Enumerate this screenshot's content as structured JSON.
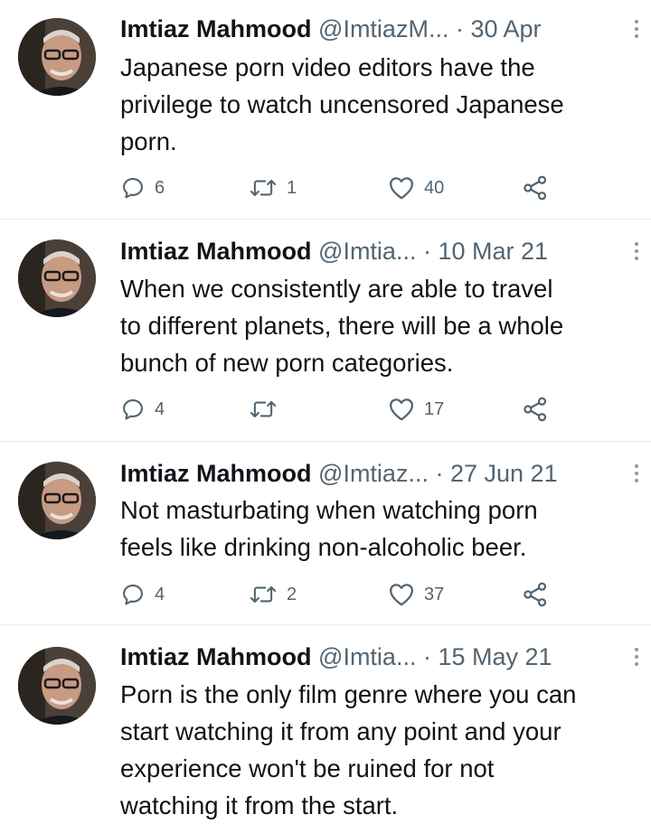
{
  "tweets": [
    {
      "author_name": "Imtiaz Mahmood",
      "handle": "@ImtiazM...",
      "separator": "·",
      "date": "30 Apr",
      "text_lines": [
        "Japanese porn video editors have the",
        "privilege to watch uncensored Japanese",
        "porn."
      ],
      "replies": "6",
      "retweets": "1",
      "likes": "40"
    },
    {
      "author_name": "Imtiaz Mahmood",
      "handle": "@Imtia...",
      "separator": "·",
      "date": "10 Mar 21",
      "text_lines": [
        "When we consistently are able to travel",
        "to different planets, there will be a whole",
        "bunch of new porn categories."
      ],
      "replies": "4",
      "retweets": "",
      "likes": "17"
    },
    {
      "author_name": "Imtiaz Mahmood",
      "handle": "@Imtiaz...",
      "separator": "·",
      "date": "27 Jun 21",
      "text_lines": [
        "Not masturbating when watching porn",
        "feels like drinking non-alcoholic beer."
      ],
      "replies": "4",
      "retweets": "2",
      "likes": "37"
    },
    {
      "author_name": "Imtiaz Mahmood",
      "handle": "@Imtia...",
      "separator": "·",
      "date": "15 May 21",
      "text_lines": [
        "Porn is the only film genre where you can",
        "start watching it from any point and your",
        "experience won't be ruined for not",
        "watching it from the start."
      ],
      "replies": "",
      "retweets": "",
      "likes": ""
    }
  ],
  "icons": {
    "reply": "reply-icon",
    "retweet": "retweet-icon",
    "like": "heart-icon",
    "share": "share-icon",
    "more": "more-options-icon"
  },
  "colors": {
    "text_primary": "#0f1419",
    "text_secondary": "#536471",
    "divider": "#e6ecf0"
  }
}
